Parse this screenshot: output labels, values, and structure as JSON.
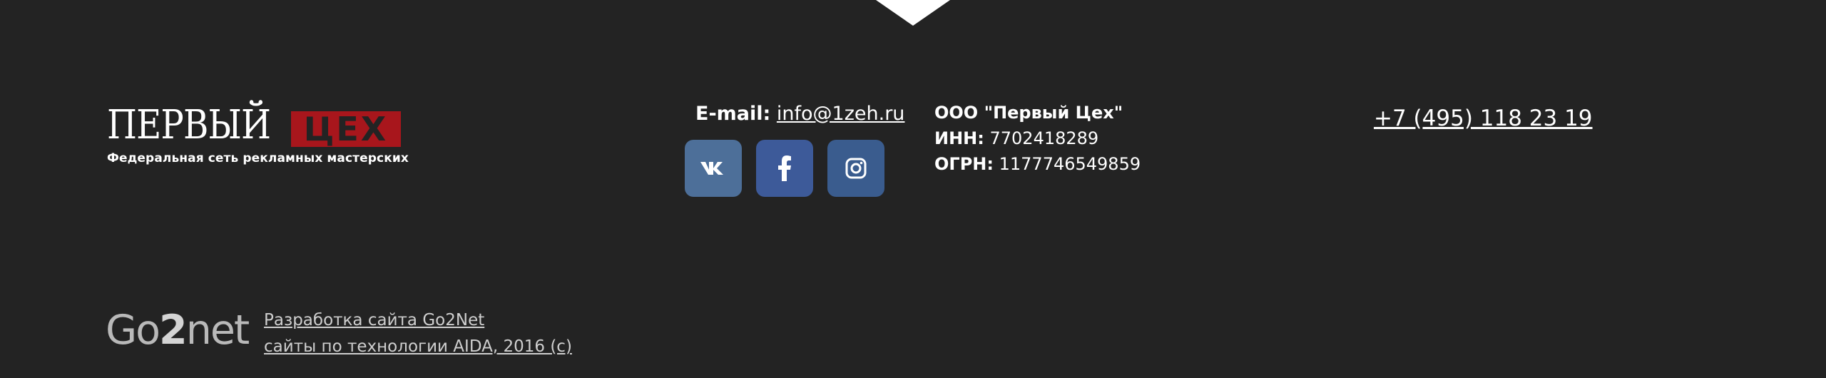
{
  "logo": {
    "word_left": "ПЕРВЫЙ",
    "word_right": "ЦЕХ",
    "tagline": "Федеральная сеть рекламных мастерских"
  },
  "contact": {
    "email_label": "E-mail:",
    "email": "info@1zeh.ru"
  },
  "social": [
    {
      "name": "vk",
      "icon": "vk-icon"
    },
    {
      "name": "facebook",
      "icon": "facebook-icon"
    },
    {
      "name": "instagram",
      "icon": "instagram-icon"
    }
  ],
  "company": {
    "name": "ООО \"Первый Цех\"",
    "inn_label": "ИНН:",
    "inn": "7702418289",
    "ogrn_label": "ОГРН:",
    "ogrn": "1177746549859"
  },
  "phone": "+7 (495) 118 23 19",
  "footer": {
    "dev_logo_a": "Go",
    "dev_logo_b": "2",
    "dev_logo_c": "net",
    "dev_link_1": "Разработка сайта Go2Net",
    "dev_link_2": "сайты по технологии AIDA, 2016 (c)"
  },
  "colors": {
    "background": "#232323",
    "brand_red": "#a8161c",
    "vk": "#4d6f99",
    "facebook": "#3d5a99",
    "instagram": "#3a5c8e"
  }
}
